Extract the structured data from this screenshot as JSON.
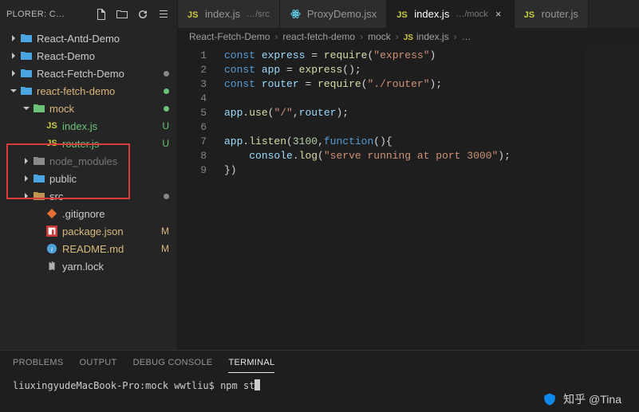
{
  "sidebar": {
    "header": "PLORER: C…",
    "items": [
      {
        "label": "React-Antd-Demo",
        "icon": "folder-blue",
        "indent": 10,
        "caret": "right"
      },
      {
        "label": "React-Demo",
        "icon": "folder-blue",
        "indent": 10,
        "caret": "right"
      },
      {
        "label": "React-Fetch-Demo",
        "icon": "folder-blue",
        "indent": 10,
        "caret": "right",
        "dot": "grey"
      },
      {
        "label": "react-fetch-demo",
        "icon": "folder-blue",
        "indent": 10,
        "caret": "down",
        "dot": "green",
        "highlight": true
      },
      {
        "label": "mock",
        "icon": "folder-green",
        "indent": 26,
        "caret": "down",
        "dot": "green",
        "highlight": true
      },
      {
        "label": "index.js",
        "icon": "js",
        "indent": 42,
        "status": "U",
        "git": "U"
      },
      {
        "label": "router.js",
        "icon": "js",
        "indent": 42,
        "status": "U",
        "git": "U"
      },
      {
        "label": "node_modules",
        "icon": "folder-grey",
        "indent": 26,
        "caret": "right",
        "dim": true
      },
      {
        "label": "public",
        "icon": "folder-blue",
        "indent": 26,
        "caret": "right"
      },
      {
        "label": "src",
        "icon": "folder-orange",
        "indent": 26,
        "caret": "right",
        "dot": "grey"
      },
      {
        "label": ".gitignore",
        "icon": "git",
        "indent": 42
      },
      {
        "label": "package.json",
        "icon": "npm",
        "indent": 42,
        "status": "M",
        "git": "M"
      },
      {
        "label": "README.md",
        "icon": "info",
        "indent": 42,
        "status": "M",
        "git": "M"
      },
      {
        "label": "yarn.lock",
        "icon": "yarn",
        "indent": 42
      }
    ]
  },
  "tabs": [
    {
      "icon": "js",
      "label": "index.js",
      "sub": "…/src"
    },
    {
      "icon": "react",
      "label": "ProxyDemo.jsx"
    },
    {
      "icon": "js",
      "label": "index.js",
      "sub": "…/mock",
      "active": true,
      "close": true
    },
    {
      "icon": "js",
      "label": "router.js"
    }
  ],
  "breadcrumbs": [
    "React-Fetch-Demo",
    "react-fetch-demo",
    "mock",
    "JS index.js",
    "…"
  ],
  "code": {
    "lines": 9,
    "html": [
      "<span class='tk-kw'>const</span> <span class='tk-var'>express</span> <span class='tk-pun'>=</span> <span class='tk-fn'>require</span><span class='tk-pun'>(</span><span class='tk-str'>\"express\"</span><span class='tk-pun'>)</span>",
      "<span class='tk-kw'>const</span> <span class='tk-var'>app</span> <span class='tk-pun'>=</span> <span class='tk-fn'>express</span><span class='tk-pun'>();</span>",
      "<span class='tk-kw'>const</span> <span class='tk-var'>router</span> <span class='tk-pun'>=</span> <span class='tk-fn'>require</span><span class='tk-pun'>(</span><span class='tk-str'>\"./router\"</span><span class='tk-pun'>);</span>",
      "",
      "<span class='tk-obj'>app</span><span class='tk-pun'>.</span><span class='tk-fn'>use</span><span class='tk-pun'>(</span><span class='tk-str'>\"/\"</span><span class='tk-pun'>,</span><span class='tk-obj'>router</span><span class='tk-pun'>);</span>",
      "",
      "<span class='tk-obj'>app</span><span class='tk-pun'>.</span><span class='tk-fn'>listen</span><span class='tk-pun'>(</span><span class='tk-num'>3100</span><span class='tk-pun'>,</span><span class='tk-kw'>function</span><span class='tk-pun'>(){</span>",
      "    <span class='tk-obj'>console</span><span class='tk-pun'>.</span><span class='tk-fn'>log</span><span class='tk-pun'>(</span><span class='tk-str'>\"serve running at port 3000\"</span><span class='tk-pun'>);</span>",
      "<span class='tk-pun'>})</span>"
    ]
  },
  "panel": {
    "tabs": [
      "PROBLEMS",
      "OUTPUT",
      "DEBUG CONSOLE",
      "TERMINAL"
    ],
    "active": 3,
    "terminal_line": "liuxingyudeMacBook-Pro:mock wwtliu$ npm st"
  },
  "watermark": "知乎 @Tina"
}
